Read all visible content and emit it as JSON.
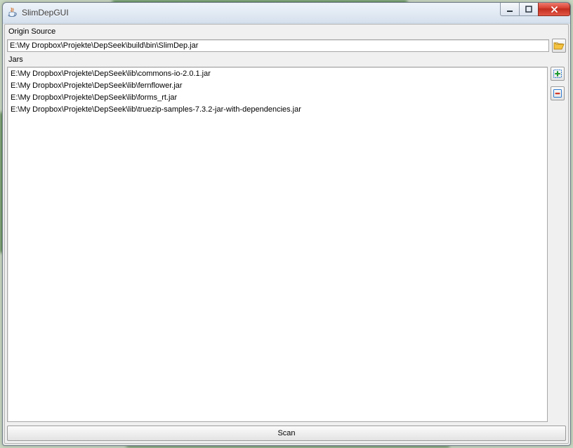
{
  "window": {
    "title": "SlimDepGUI"
  },
  "labels": {
    "origin_source": "Origin Source",
    "jars": "Jars"
  },
  "origin_source": {
    "value": "E:\\My Dropbox\\Projekte\\DepSeek\\build\\bin\\SlimDep.jar"
  },
  "jars": {
    "items": [
      "E:\\My Dropbox\\Projekte\\DepSeek\\lib\\commons-io-2.0.1.jar",
      "E:\\My Dropbox\\Projekte\\DepSeek\\lib\\fernflower.jar",
      "E:\\My Dropbox\\Projekte\\DepSeek\\lib\\forms_rt.jar",
      "E:\\My Dropbox\\Projekte\\DepSeek\\lib\\truezip-samples-7.3.2-jar-with-dependencies.jar"
    ]
  },
  "buttons": {
    "scan": "Scan"
  },
  "icons": {
    "app": "java-cup-icon",
    "minimize": "minimize-icon",
    "maximize": "maximize-icon",
    "close": "close-icon",
    "browse": "folder-open-icon",
    "add": "add-icon",
    "remove": "remove-icon"
  }
}
